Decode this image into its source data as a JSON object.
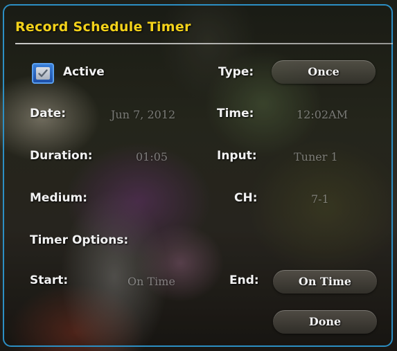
{
  "dialog": {
    "title": "Record Schedule Timer",
    "active": {
      "label": "Active",
      "checked": true
    },
    "fields": {
      "type": {
        "label": "Type:",
        "value": "Once"
      },
      "date": {
        "label": "Date:",
        "value": "Jun 7, 2012"
      },
      "time": {
        "label": "Time:",
        "value": "12:02AM"
      },
      "duration": {
        "label": "Duration:",
        "value": "01:05"
      },
      "input": {
        "label": "Input:",
        "value": "Tuner 1"
      },
      "medium": {
        "label": "Medium:",
        "value": ""
      },
      "channel": {
        "label": "CH:",
        "value": "7-1"
      }
    },
    "timer_options": {
      "heading": "Timer Options:",
      "start": {
        "label": "Start:",
        "value": "On Time"
      },
      "end": {
        "label": "End:",
        "value": "On Time"
      }
    },
    "done_label": "Done"
  },
  "colors": {
    "title": "#f3d21a",
    "frame_border": "#2c8fc4",
    "checkbox": "#2a63c4"
  }
}
